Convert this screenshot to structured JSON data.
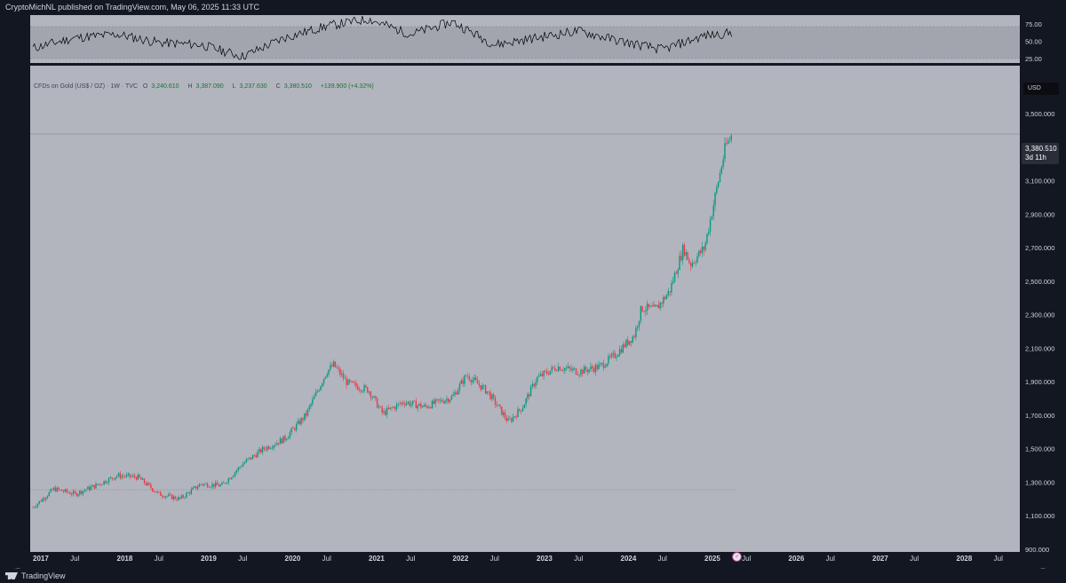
{
  "header": {
    "published_text": "CryptoMichNL published on TradingView.com, May 06, 2025 11:33 UTC"
  },
  "legend": {
    "symbol": "CFDs on Gold (US$ / OZ) · 1W · TVC",
    "open_label": "O",
    "open": "3,240.610",
    "high_label": "H",
    "high": "3,387.090",
    "low_label": "L",
    "low": "3,237.630",
    "close_label": "C",
    "close": "3,380.510",
    "change": "+139.900 (+4.32%)"
  },
  "price_axis": {
    "currency": "USD",
    "last_price": "3,380.510",
    "countdown": "3d 11h",
    "ticks": [
      "3,500.000",
      "3,300.000",
      "3,100.000",
      "2,900.000",
      "2,700.000",
      "2,500.000",
      "2,300.000",
      "2,100.000",
      "1,900.000",
      "1,700.000",
      "1,500.000",
      "1,300.000",
      "1,100.000",
      "900.000"
    ]
  },
  "rsi_axis": {
    "ticks": [
      "75.00",
      "50.00",
      "25.00"
    ]
  },
  "time_axis": {
    "labels": [
      "2017",
      "Jul",
      "2018",
      "Jul",
      "2019",
      "Jul",
      "2020",
      "Jul",
      "2021",
      "Jul",
      "2022",
      "Jul",
      "2023",
      "Jul",
      "2024",
      "Jul",
      "2025",
      "Jul",
      "2026",
      "Jul",
      "2027",
      "Jul",
      "2028",
      "Jul"
    ]
  },
  "footer": {
    "brand": "TradingView"
  },
  "colors": {
    "background": "#131722",
    "pane": "#b2b5be",
    "up": "#089981",
    "down": "#f23645",
    "rsi_line": "#000000",
    "rsi_band": "#9598a1"
  },
  "chart_data": [
    {
      "type": "line",
      "title": "CFDs on Gold (US$ / OZ) · 1W · TVC",
      "ylabel": "USD",
      "ylim": [
        900,
        3600
      ],
      "x": [
        "2017-01",
        "2017-04",
        "2017-07",
        "2017-10",
        "2018-01",
        "2018-04",
        "2018-07",
        "2018-10",
        "2019-01",
        "2019-04",
        "2019-07",
        "2019-10",
        "2020-01",
        "2020-04",
        "2020-07",
        "2020-08",
        "2020-10",
        "2021-01",
        "2021-03",
        "2021-06",
        "2021-09",
        "2022-01",
        "2022-03",
        "2022-06",
        "2022-09",
        "2022-11",
        "2023-01",
        "2023-04",
        "2023-07",
        "2023-10",
        "2023-12",
        "2024-03",
        "2024-04",
        "2024-06",
        "2024-08",
        "2024-10",
        "2024-11",
        "2025-01",
        "2025-02",
        "2025-04",
        "2025-05"
      ],
      "series": [
        {
          "values": [
            1150,
            1260,
            1230,
            1280,
            1340,
            1330,
            1230,
            1200,
            1290,
            1280,
            1410,
            1500,
            1560,
            1700,
            1960,
            2000,
            1890,
            1850,
            1710,
            1780,
            1750,
            1810,
            1940,
            1840,
            1660,
            1750,
            1920,
            1990,
            1960,
            1990,
            2050,
            2180,
            2340,
            2330,
            2440,
            2700,
            2600,
            2700,
            2900,
            3300,
            3380
          ]
        }
      ]
    },
    {
      "type": "line",
      "title": "",
      "ylim": [
        20,
        90
      ],
      "x": [
        "2017",
        "2017-07",
        "2018",
        "2018-07",
        "2019",
        "2019-07",
        "2020",
        "2020-07",
        "2021",
        "2021-07",
        "2022",
        "2022-07",
        "2023",
        "2023-07",
        "2024",
        "2024-07",
        "2025",
        "2025-05"
      ],
      "series": [
        {
          "values": [
            40,
            55,
            60,
            48,
            45,
            28,
            55,
            72,
            82,
            60,
            78,
            45,
            55,
            65,
            50,
            38,
            58,
            62
          ]
        }
      ]
    }
  ]
}
